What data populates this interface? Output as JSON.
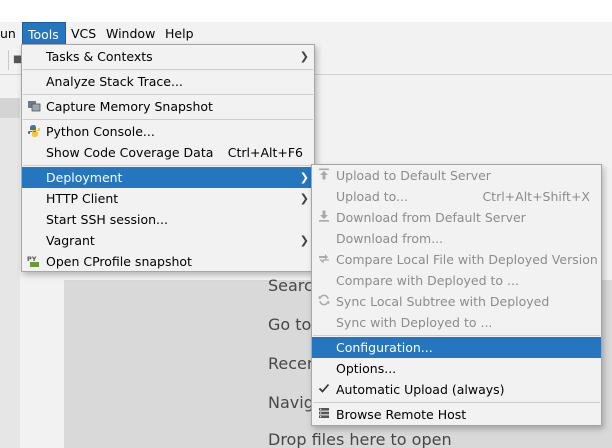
{
  "menubar": {
    "items": [
      {
        "label": "un",
        "id": "run"
      },
      {
        "label": "Tools",
        "id": "tools"
      },
      {
        "label": "VCS",
        "id": "vcs"
      },
      {
        "label": "Window",
        "id": "window"
      },
      {
        "label": "Help",
        "id": "help"
      }
    ]
  },
  "tools_menu": {
    "items": [
      {
        "label": "Tasks & Contexts"
      },
      {
        "label": "Analyze Stack Trace..."
      },
      {
        "label": "Capture Memory Snapshot"
      },
      {
        "label": "Python Console..."
      },
      {
        "label": "Show Code Coverage Data",
        "shortcut": "Ctrl+Alt+F6"
      },
      {
        "label": "Deployment"
      },
      {
        "label": "HTTP Client"
      },
      {
        "label": "Start SSH session..."
      },
      {
        "label": "Vagrant"
      },
      {
        "label": "Open CProfile snapshot"
      }
    ]
  },
  "deployment_menu": {
    "items": [
      {
        "label": "Upload to Default Server"
      },
      {
        "label": "Upload to...",
        "shortcut": "Ctrl+Alt+Shift+X"
      },
      {
        "label": "Download from Default Server"
      },
      {
        "label": "Download from..."
      },
      {
        "label": "Compare Local File with Deployed Version"
      },
      {
        "label": "Compare with Deployed to ..."
      },
      {
        "label": "Sync Local Subtree with Deployed"
      },
      {
        "label": "Sync with Deployed to ..."
      },
      {
        "label": "Configuration..."
      },
      {
        "label": "Options..."
      },
      {
        "label": "Automatic Upload (always)"
      },
      {
        "label": "Browse Remote Host"
      }
    ]
  },
  "welcome": {
    "search": "Searc",
    "goto": "Go to",
    "recent": "Recen",
    "navigation": "Navig",
    "drop": "Drop files here to open"
  },
  "colors": {
    "selection": "#2675bf",
    "menu_bg": "#f2f2f2",
    "disabled_text": "#8c8c8c"
  }
}
